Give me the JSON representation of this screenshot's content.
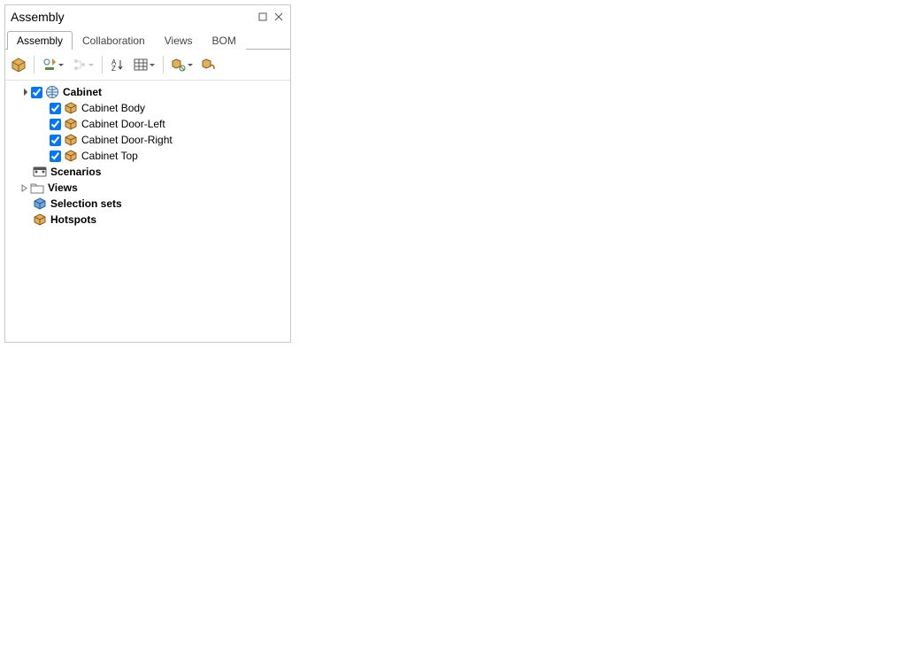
{
  "panel": {
    "title": "Assembly",
    "tabs": [
      "Assembly",
      "Collaboration",
      "Views",
      "BOM"
    ],
    "active_tab": "Assembly",
    "toolbar": {
      "tools": [
        {
          "name": "root-assembly-icon",
          "kind": "box-gold"
        },
        {
          "name": "configure-icon",
          "kind": "cfg",
          "dropdown": true
        },
        {
          "name": "show-hierarchy-icon",
          "kind": "hier",
          "disabled": true,
          "dropdown": true
        },
        {
          "name": "sort-icon",
          "kind": "sort"
        },
        {
          "name": "table-icon",
          "kind": "table",
          "dropdown": true
        },
        {
          "name": "link-icon",
          "kind": "link",
          "dropdown": true
        },
        {
          "name": "attach-icon",
          "kind": "attach"
        }
      ]
    },
    "tree": {
      "root": {
        "label": "Cabinet",
        "checked": true,
        "children": [
          {
            "label": "Cabinet Body",
            "checked": true
          },
          {
            "label": "Cabinet Door-Left",
            "checked": true
          },
          {
            "label": "Cabinet Door-Right",
            "checked": true
          },
          {
            "label": "Cabinet Top",
            "checked": true
          }
        ]
      },
      "scenarios_label": "Scenarios",
      "views_label": "Views",
      "selection_sets_label": "Selection sets",
      "hotspots_label": "Hotspots"
    }
  },
  "model": {
    "name": "Cabinet",
    "colors": {
      "wood_light": "#c99a4f",
      "wood_mid": "#b27c32",
      "wood_dark": "#8a5a20",
      "body_dark": "#1f1810",
      "side_blue": "#3a3f7a",
      "side_blue_shade": "#2d3160",
      "handle": "#9fa6ae",
      "handle_hi": "#d8dde3",
      "edge": "#000000"
    }
  }
}
